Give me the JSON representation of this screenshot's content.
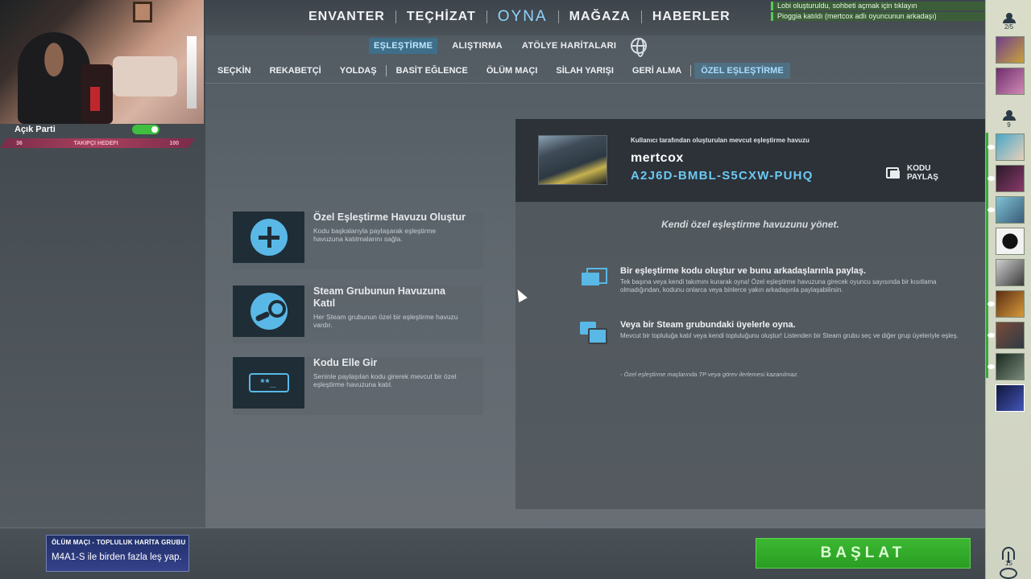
{
  "stream": {
    "party_label": "Açık Parti",
    "rank_left": "36",
    "rank_middle": "TAKIPÇI HEDEFI",
    "rank_right": "100"
  },
  "top_nav": {
    "items": [
      "ENVANTER",
      "TEÇHİZAT",
      "OYNA",
      "MAĞAZA",
      "HABERLER"
    ],
    "active": "OYNA"
  },
  "notifications": [
    "Lobi oluşturuldu, sohbeti açmak için tıklayın",
    "Pioggia katıldı (mertcox adlı oyuncunun arkadaşı)"
  ],
  "sub_nav": {
    "tabs": [
      "EŞLEŞTİRME",
      "ALIŞTIRMA",
      "ATÖLYE HARİTALARI"
    ],
    "active": "EŞLEŞTİRME",
    "icon": "globe-icon"
  },
  "mode_nav": {
    "modes": [
      "SEÇKİN",
      "REKABETÇİ",
      "YOLDAŞ",
      "BASİT EĞLENCE",
      "ÖLÜM MAÇI",
      "SİLAH YARIŞI",
      "GERİ ALMA",
      "ÖZEL EŞLEŞTİRME"
    ],
    "active": "ÖZEL EŞLEŞTİRME"
  },
  "options": [
    {
      "title": "Özel Eşleştirme Havuzu Oluştur",
      "desc": "Kodu başkalarıyla paylaşarak eşleştirme havuzuna katılmalarını sağla.",
      "icon": "plus-icon"
    },
    {
      "title": "Steam Grubunun Havuzuna Katıl",
      "desc": "Her Steam grubunun özel bir eşleştirme havuzu vardır.",
      "icon": "steam-icon"
    },
    {
      "title": "Kodu Elle Gir",
      "desc": "Seninle paylaşılan kodu girerek mevcut bir özel eşleştirme havuzuna katıl.",
      "icon": "code-icon",
      "icon_text": "**_"
    }
  ],
  "lobby": {
    "caption": "Kullanıcı tarafından oluşturulan mevcut eşleştirme havuzu",
    "name": "mertcox",
    "code": "A2J6D-BMBL-S5CXW-PUHQ",
    "share_label": "KODU PAYLAŞ"
  },
  "panel": {
    "manage_text": "Kendi özel eşleştirme havuzunu yönet.",
    "features": [
      {
        "title": "Bir eşleştirme kodu oluştur ve bunu arkadaşlarınla paylaş.",
        "desc": "Tek başına veya kendi takımını kurarak oyna! Özel eşleştirme havuzuna girecek oyuncu sayısında bir kısıtlama olmadığından, kodunu onlarca veya binlerce yakın arkadaşınla paylaşabilirsin."
      },
      {
        "title": "Veya bir Steam grubundaki üyelerle oyna.",
        "desc": "Mevcut bir topluluğa katıl veya kendi topluluğunu oluştur! Listenden bir Steam grubu seç ve diğer grup üyeleriyle eşleş."
      }
    ],
    "note": "- Özel eşleştirme maçlarında TP veya görev ilerlemesi kazanılmaz."
  },
  "bottom": {
    "event_title": "ÖLÜM MAÇI - TOPLULUK HARİTA GRUBU",
    "event_sub": "M4A1-S ile birden fazla leş yap.",
    "start_label": "BAŞLAT",
    "accent": "#3cb832"
  },
  "sidebar": {
    "party_count": "2/5",
    "friends_count": "9",
    "bottom_count": "15"
  }
}
